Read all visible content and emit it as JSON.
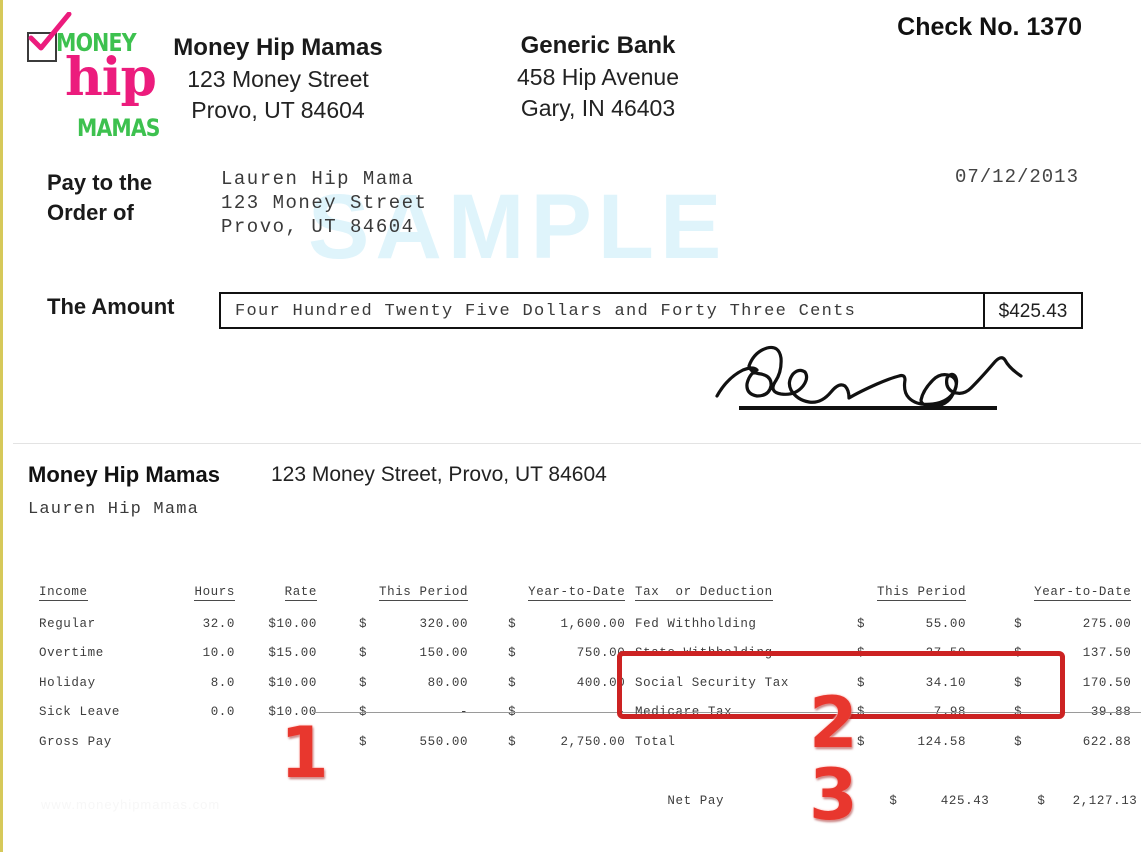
{
  "document": {
    "type": "check-and-paystub",
    "watermark": "SAMPLE",
    "watermark_bottom": "www.moneyhipmamas.com"
  },
  "logo": {
    "word_top": "MONEY",
    "word_mid": "hip",
    "word_bottom": "MAMAS",
    "checkbox_icon": "checkbox-checked-icon",
    "color_green": "#3dc14f",
    "color_pink": "#ec1c7d"
  },
  "check": {
    "company": {
      "name": "Money Hip Mamas",
      "street": "123 Money Street",
      "city_state_zip": "Provo, UT 84604"
    },
    "bank": {
      "name": "Generic Bank",
      "street": "458 Hip Avenue",
      "city_state_zip": "Gary, IN 46403"
    },
    "check_no_label": "Check No. 1370",
    "pay_to_label": "Pay to the\nOrder of",
    "payee": {
      "name": "Lauren Hip Mama",
      "street": "123 Money Street",
      "city_state_zip": "Provo, UT 84604"
    },
    "date": "07/12/2013",
    "amount_label": "The Amount",
    "amount_words": "Four Hundred Twenty Five Dollars and Forty Three Cents",
    "amount_figure": "$425.43",
    "signature_icon": "handwritten-signature"
  },
  "paystub": {
    "company_name": "Money Hip Mamas",
    "company_address": "123 Money Street, Provo, UT 84604",
    "employee_name": "Lauren Hip Mama",
    "income": {
      "headers": [
        "Income",
        "Hours",
        "Rate",
        "This Period",
        "Year-to-Date"
      ],
      "rows": [
        {
          "label": "Regular",
          "hours": "32.0",
          "rate": "$10.00",
          "tp_cur": "$",
          "this_period": "320.00",
          "ytd_cur": "$",
          "ytd": "1,600.00"
        },
        {
          "label": "Overtime",
          "hours": "10.0",
          "rate": "$15.00",
          "tp_cur": "$",
          "this_period": "150.00",
          "ytd_cur": "$",
          "ytd": "750.00"
        },
        {
          "label": "Holiday",
          "hours": "8.0",
          "rate": "$10.00",
          "tp_cur": "$",
          "this_period": "80.00",
          "ytd_cur": "$",
          "ytd": "400.00"
        },
        {
          "label": "Sick Leave",
          "hours": "0.0",
          "rate": "$10.00",
          "tp_cur": "$",
          "this_period": "-",
          "ytd_cur": "$",
          "ytd": "-"
        }
      ],
      "total": {
        "label": "Gross Pay",
        "hours": "",
        "rate": "",
        "tp_cur": "$",
        "this_period": "550.00",
        "ytd_cur": "$",
        "ytd": "2,750.00"
      }
    },
    "deductions": {
      "headers": [
        "Tax  or Deduction",
        "This Period",
        "Year-to-Date"
      ],
      "rows": [
        {
          "label": "Fed Withholding",
          "tp_cur": "$",
          "this_period": "55.00",
          "ytd_cur": "$",
          "ytd": "275.00"
        },
        {
          "label": "State Withholding",
          "tp_cur": "$",
          "this_period": "27.50",
          "ytd_cur": "$",
          "ytd": "137.50"
        },
        {
          "label": "Social Security Tax",
          "tp_cur": "$",
          "this_period": "34.10",
          "ytd_cur": "$",
          "ytd": "170.50"
        },
        {
          "label": "Medicare Tax",
          "tp_cur": "$",
          "this_period": "7.98",
          "ytd_cur": "$",
          "ytd": "39.88"
        }
      ],
      "total": {
        "label": "Total",
        "tp_cur": "$",
        "this_period": "124.58",
        "ytd_cur": "$",
        "ytd": "622.88"
      }
    },
    "net_pay": {
      "label": "Net Pay",
      "tp_cur": "$",
      "this_period": "425.43",
      "ytd_cur": "$",
      "ytd": "2,127.13"
    }
  },
  "annotations": {
    "callout_1": "1",
    "callout_2": "2",
    "callout_3": "3",
    "highlight_color": "#cc2222",
    "callout_color": "#e8372e"
  }
}
